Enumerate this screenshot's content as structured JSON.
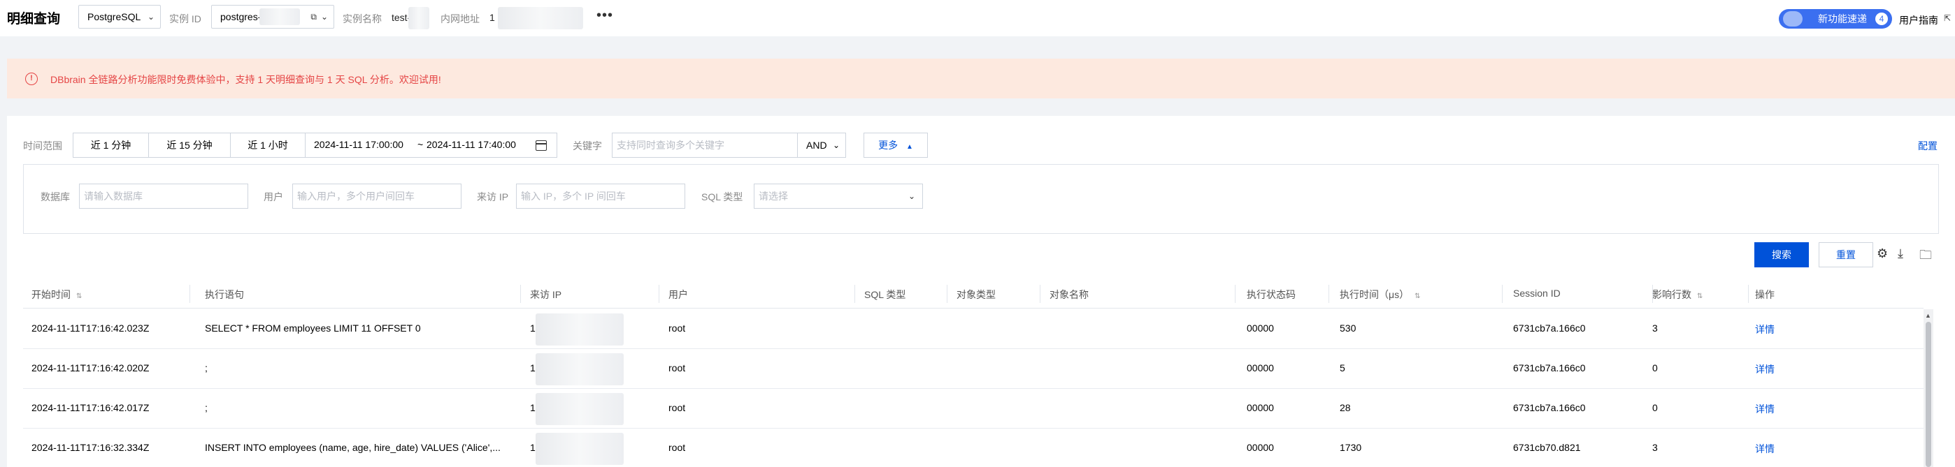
{
  "header": {
    "title": "明细查询",
    "db_type": "PostgreSQL",
    "instance_id_label": "实例 ID",
    "instance_id_value": "postgres-",
    "instance_name_label": "实例名称",
    "instance_name_value": "test-",
    "intranet_label": "内网地址",
    "intranet_value": "1",
    "more": "•••",
    "new_feature_label": "新功能速递",
    "new_feature_count": "4",
    "user_guide": "用户指南"
  },
  "banner": {
    "message": "DBbrain 全链路分析功能限时免费体验中，支持 1 天明细查询与 1 天 SQL 分析。欢迎试用!"
  },
  "filters": {
    "time_range_label": "时间范围",
    "quick_ranges": [
      "近 1 分钟",
      "近 15 分钟",
      "近 1 小时"
    ],
    "start_time": "2024-11-11 17:00:00",
    "range_sep": "~",
    "end_time": "2024-11-11 17:40:00",
    "keyword_label": "关键字",
    "keyword_placeholder": "支持同时查询多个关键字",
    "logic_op": "AND",
    "more_button": "更多",
    "config_link": "配置",
    "database_label": "数据库",
    "database_placeholder": "请输入数据库",
    "user_label": "用户",
    "user_placeholder": "输入用户，多个用户间回车",
    "source_ip_label": "来访 IP",
    "source_ip_placeholder": "输入 IP，多个 IP 间回车",
    "sql_type_label": "SQL 类型",
    "sql_type_placeholder": "请选择"
  },
  "actions": {
    "search": "搜索",
    "reset": "重置"
  },
  "table": {
    "columns": [
      "开始时间",
      "执行语句",
      "来访 IP",
      "用户",
      "SQL 类型",
      "对象类型",
      "对象名称",
      "执行状态码",
      "执行时间（μs）",
      "Session ID",
      "影响行数",
      "操作"
    ],
    "rows": [
      [
        "2024-11-11T17:16:42.023Z",
        "SELECT * FROM employees LIMIT 11 OFFSET 0",
        "1",
        "root",
        "",
        "",
        "",
        "00000",
        "530",
        "6731cb7a.166c0",
        "3",
        "详情"
      ],
      [
        "2024-11-11T17:16:42.020Z",
        ";",
        "1",
        "root",
        "",
        "",
        "",
        "00000",
        "5",
        "6731cb7a.166c0",
        "0",
        "详情"
      ],
      [
        "2024-11-11T17:16:42.017Z",
        ";",
        "1",
        "root",
        "",
        "",
        "",
        "00000",
        "28",
        "6731cb7a.166c0",
        "0",
        "详情"
      ],
      [
        "2024-11-11T17:16:32.334Z",
        "INSERT INTO employees (name, age, hire_date) VALUES ('Alice',...",
        "1",
        "root",
        "",
        "",
        "",
        "00000",
        "1730",
        "6731cb70.d821",
        "3",
        "详情"
      ]
    ]
  }
}
